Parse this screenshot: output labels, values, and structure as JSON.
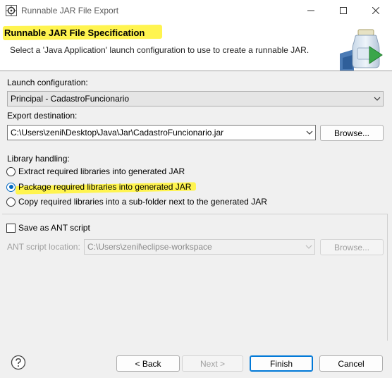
{
  "window": {
    "title": "Runnable JAR File Export"
  },
  "header": {
    "title": "Runnable JAR File Specification",
    "message": "Select a 'Java Application' launch configuration to use to create a runnable JAR."
  },
  "launch_config": {
    "label": "Launch configuration:",
    "value": "Principal - CadastroFuncionario"
  },
  "export_destination": {
    "label": "Export destination:",
    "value": "C:\\Users\\zenil\\Desktop\\Java\\Jar\\CadastroFuncionario.jar",
    "browse_label": "Browse..."
  },
  "library_handling": {
    "label": "Library handling:",
    "options": [
      {
        "label": "Extract required libraries into generated JAR",
        "checked": false
      },
      {
        "label": "Package required libraries into generated JAR",
        "checked": true
      },
      {
        "label": "Copy required libraries into a sub-folder next to the generated JAR",
        "checked": false
      }
    ]
  },
  "ant": {
    "checkbox_label": "Save as ANT script",
    "location_label": "ANT script location:",
    "location_value": "C:\\Users\\zenil\\eclipse-workspace",
    "browse_label": "Browse..."
  },
  "footer": {
    "back_label": "< Back",
    "next_label": "Next >",
    "finish_label": "Finish",
    "cancel_label": "Cancel"
  },
  "colors": {
    "highlight": "#fff44f",
    "accent": "#0078d7"
  }
}
